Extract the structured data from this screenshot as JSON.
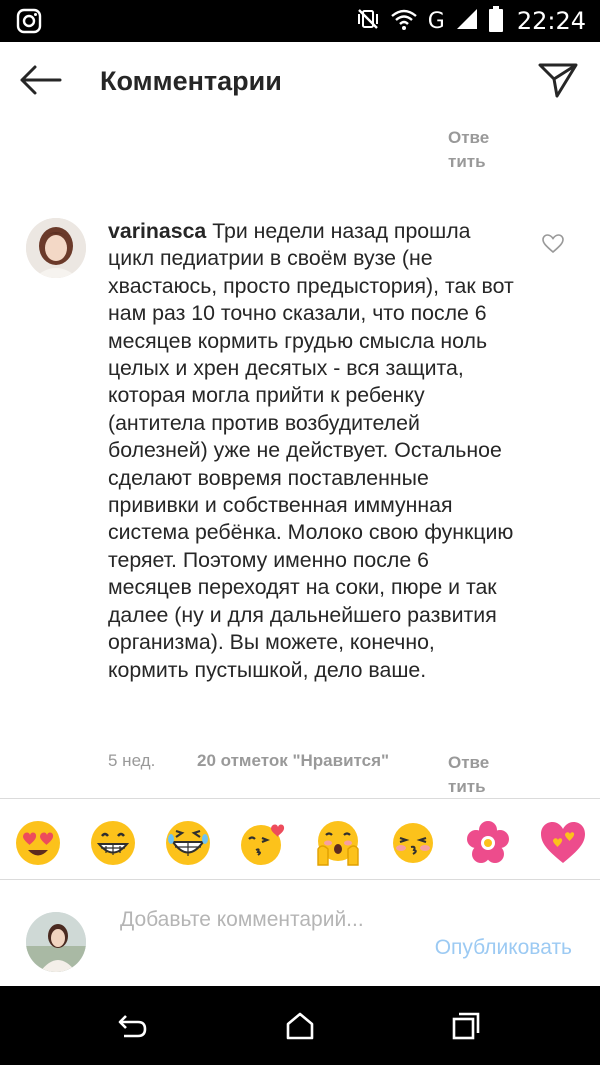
{
  "status_bar": {
    "time": "22:24",
    "network": "G",
    "icons": [
      "instagram-icon",
      "vibrate-off-icon",
      "wifi-icon",
      "signal-icon",
      "battery-icon"
    ]
  },
  "header": {
    "title": "Комментарии",
    "back_icon": "arrow-left-icon",
    "send_icon": "paper-plane-icon"
  },
  "previous_comment": {
    "reply_label": "Ответить"
  },
  "comment": {
    "username": "varinasca",
    "text": "Три недели назад прошла цикл педиатрии в своём вузе (не хвастаюсь, просто предыстория), так вот нам раз 10 точно сказали, что после 6 месяцев кормить грудью смысла ноль целых и хрен десятых - вся защита, которая могла прийти к ребенку (антитела против возбудителей болезней) уже не действует. Остальное сделают вовремя поставленные прививки и собственная иммунная система ребёнка. Молоко свою функцию теряет. Поэтому именно после 6 месяцев переходят на соки, пюре и так далее (ну и для дальнейшего развития организма). Вы можете, конечно, кормить пустышкой, дело ваше.",
    "time": "5 нед.",
    "likes": "20 отметок \"Нравится\"",
    "reply_label": "Ответить",
    "like_icon": "heart-outline-icon"
  },
  "emoji_bar": [
    "heart-eyes-emoji",
    "grinning-emoji",
    "laughing-emoji",
    "kissing-heart-emoji",
    "flushed-hands-emoji",
    "kissing-blush-emoji",
    "flower-emoji",
    "heart-emoji"
  ],
  "add_comment": {
    "placeholder": "Добавьте комментарий...",
    "publish_label": "Опубликовать"
  },
  "nav_bar": [
    "back-nav-icon",
    "home-nav-icon",
    "recents-nav-icon"
  ],
  "colors": {
    "text": "#262626",
    "secondary": "#999999",
    "publish_disabled": "#9ccaf3",
    "emoji_yellow": "#fcc21b",
    "emoji_pink": "#ed4c8c"
  }
}
